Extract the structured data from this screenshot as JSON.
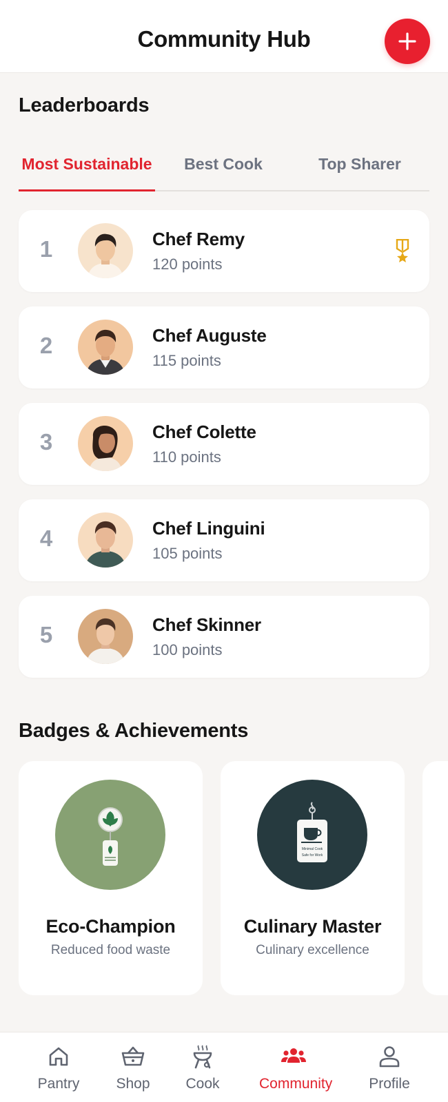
{
  "header": {
    "title": "Community Hub",
    "add_icon": "plus-icon"
  },
  "leaderboards": {
    "title": "Leaderboards",
    "tabs": [
      {
        "label": "Most Sustainable",
        "active": true
      },
      {
        "label": "Best Cook",
        "active": false
      },
      {
        "label": "Top Sharer",
        "active": false
      }
    ],
    "entries": [
      {
        "rank": "1",
        "name": "Chef Remy",
        "points": "120 points",
        "medal": true
      },
      {
        "rank": "2",
        "name": "Chef Auguste",
        "points": "115 points",
        "medal": false
      },
      {
        "rank": "3",
        "name": "Chef Colette",
        "points": "110 points",
        "medal": false
      },
      {
        "rank": "4",
        "name": "Chef Linguini",
        "points": "105 points",
        "medal": false
      },
      {
        "rank": "5",
        "name": "Chef Skinner",
        "points": "100 points",
        "medal": false
      }
    ]
  },
  "badges": {
    "title": "Badges & Achievements",
    "items": [
      {
        "title": "Eco-Champion",
        "description": "Reduced food waste",
        "circle_color": "#87a173"
      },
      {
        "title": "Culinary Master",
        "description": "Culinary excellence",
        "circle_color": "#263a3f",
        "tag_line1": "Minimal Cook",
        "tag_line2": "Safe for Work"
      }
    ]
  },
  "nav": {
    "items": [
      {
        "label": "Pantry",
        "icon": "home-icon",
        "active": false
      },
      {
        "label": "Shop",
        "icon": "basket-icon",
        "active": false
      },
      {
        "label": "Cook",
        "icon": "grill-icon",
        "active": false
      },
      {
        "label": "Community",
        "icon": "people-icon",
        "active": true
      },
      {
        "label": "Profile",
        "icon": "user-icon",
        "active": false
      }
    ]
  },
  "colors": {
    "accent": "#e1242f",
    "background": "#f7f5f3",
    "medal": "#e6a817",
    "muted_text": "#6b7280"
  }
}
